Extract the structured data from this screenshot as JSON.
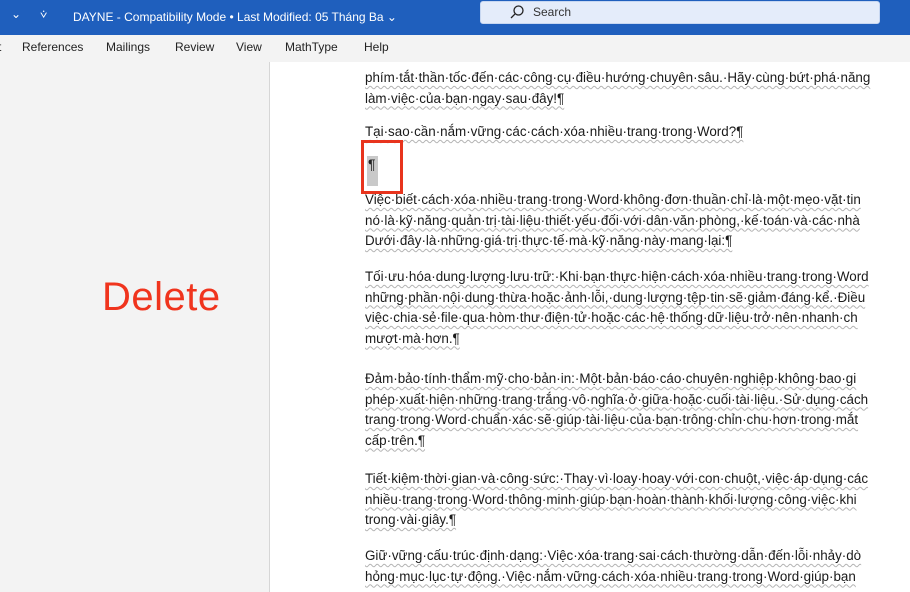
{
  "titlebar": {
    "qat_chevron": "⌄",
    "qat_customize": "⩒",
    "title": "DAYNE  -  Compatibility Mode  •  Last Modified: 05 Tháng Ba",
    "title_chevron": "⌄",
    "search_placeholder": "Search"
  },
  "ribbon": {
    "tabs": [
      "t",
      "References",
      "Mailings",
      "Review",
      "View",
      "MathType",
      "Help"
    ]
  },
  "annotation": {
    "label": "Delete",
    "color": "#f0341d"
  },
  "document": {
    "paragraphs": [
      {
        "lines": [
          "phím·tắt·thần·tốc·đến·các·công·cụ·điều·hướng·chuyên·sâu.·Hãy·cùng·bứt·phá·năng",
          "làm·việc·của·bạn·ngay·sau·đây!¶"
        ]
      },
      {
        "lines": [
          "Tại·sao·cần·nắm·vững·các·cách·xóa·nhiều·trang·trong·Word?¶"
        ]
      },
      {
        "lines": [
          "¶"
        ]
      },
      {
        "lines": [
          "Việc·biết·cách·xóa·nhiều·trang·trong·Word·không·đơn·thuần·chỉ·là·một·mẹo·vặt·tin",
          "nó·là·kỹ·năng·quản·trị·tài·liệu·thiết·yếu·đối·với·dân·văn·phòng,·kế·toán·và·các·nhà",
          "Dưới·đây·là·những·giá·trị·thực·tế·mà·kỹ·năng·này·mang·lại:¶"
        ]
      },
      {
        "lines": [
          "Tối·ưu·hóa·dung·lượng·lưu·trữ:·Khi·bạn·thực·hiện·cách·xóa·nhiều·trang·trong·Word",
          "những·phần·nội·dung·thừa·hoặc·ảnh·lỗi,·dung·lượng·tệp·tin·sẽ·giảm·đáng·kể.·Điều",
          "việc·chia·sẻ·file·qua·hòm·thư·điện·tử·hoặc·các·hệ·thống·dữ·liệu·trở·nên·nhanh·ch",
          "mượt·mà·hơn.¶"
        ]
      },
      {
        "lines": [
          "Đảm·bảo·tính·thẩm·mỹ·cho·bản·in:·Một·bản·báo·cáo·chuyên·nghiệp·không·bao·gi",
          "phép·xuất·hiện·những·trang·trắng·vô·nghĩa·ở·giữa·hoặc·cuối·tài·liệu.·Sử·dụng·cách",
          "trang·trong·Word·chuẩn·xác·sẽ·giúp·tài·liệu·của·bạn·trông·chỉn·chu·hơn·trong·mắt",
          "cấp·trên.¶"
        ]
      },
      {
        "lines": [
          "Tiết·kiệm·thời·gian·và·công·sức:·Thay·vì·loay·hoay·với·con·chuột,·việc·áp·dụng·các",
          "nhiều·trang·trong·Word·thông·minh·giúp·bạn·hoàn·thành·khối·lượng·công·việc·khi",
          "trong·vài·giây.¶"
        ]
      },
      {
        "lines": [
          "Giữ·vững·cấu·trúc·định·dạng:·Việc·xóa·trang·sai·cách·thường·dẫn·đến·lỗi·nhảy·dò",
          "hỏng·mục·lục·tự·động.·Việc·nắm·vững·cách·xóa·nhiều·trang·trong·Word·giúp·bạn"
        ]
      }
    ]
  }
}
